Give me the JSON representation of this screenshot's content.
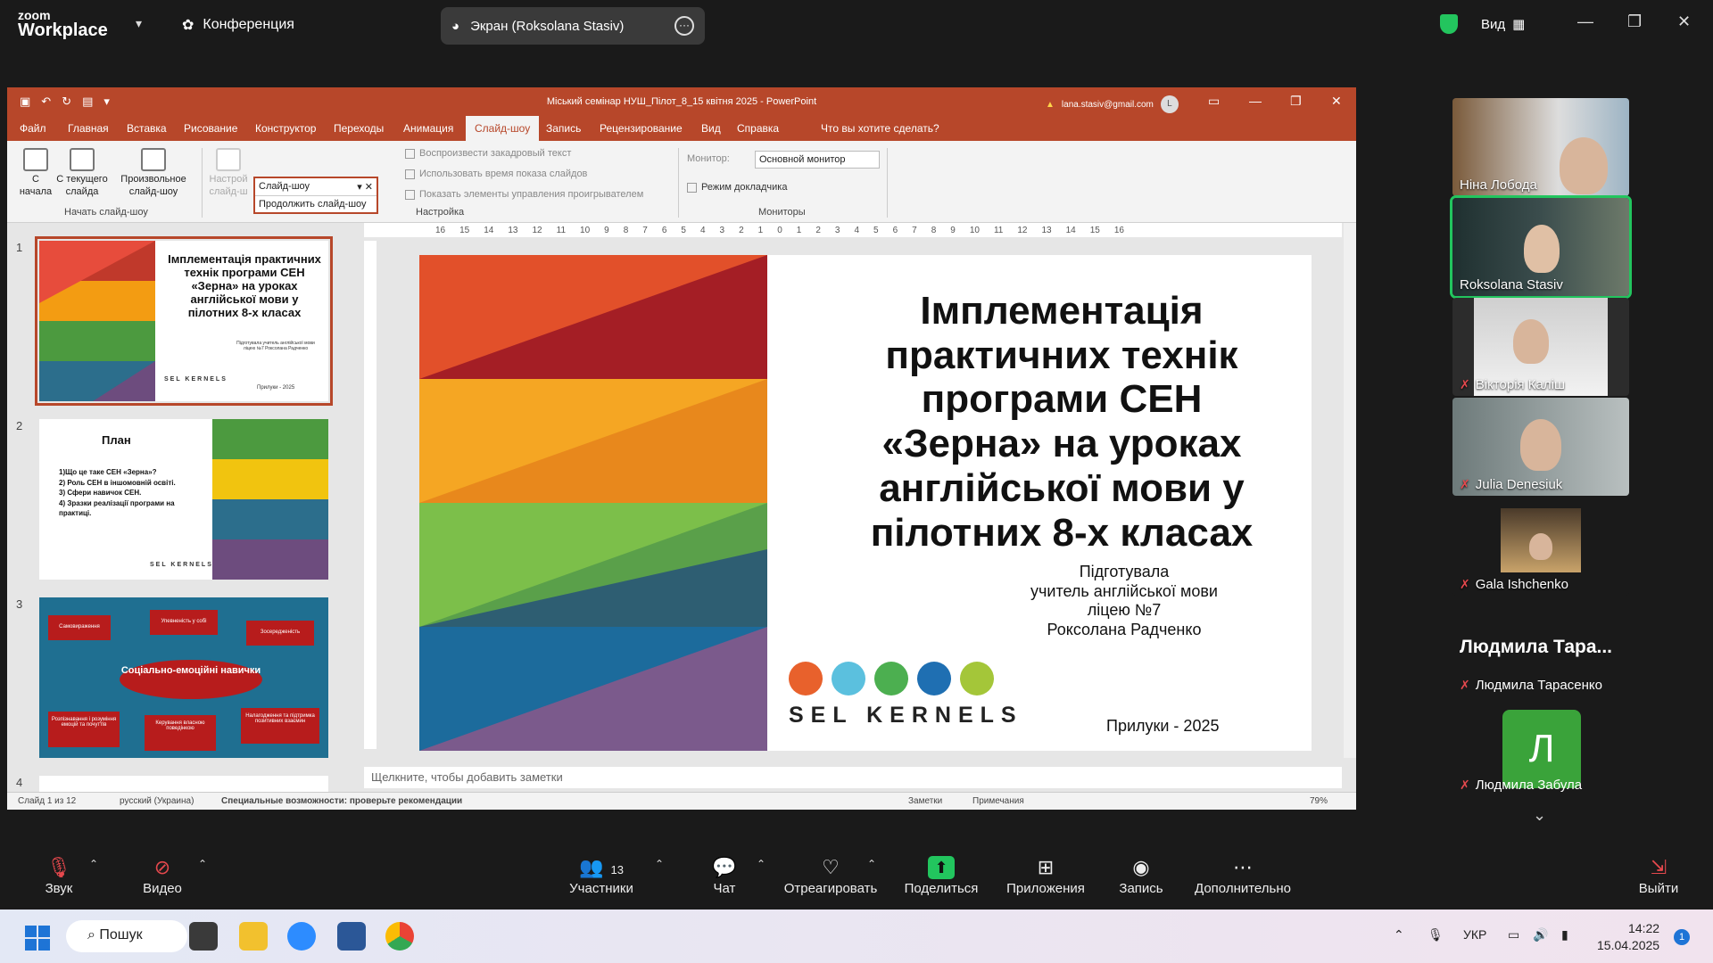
{
  "zoom": {
    "brand_line1": "zoom",
    "brand_line2": "Workplace",
    "conference_label": "Конференция",
    "screen_share_label": "Экран (Roksolana Stasiv)",
    "view_label": "Вид"
  },
  "ppt": {
    "doc_title": "Міський семінар НУШ_Пілот_8_15 квітня 2025  -  PowerPoint",
    "account_email": "lana.stasiv@gmail.com",
    "account_initial": "L",
    "tabs": [
      "Файл",
      "Главная",
      "Вставка",
      "Рисование",
      "Конструктор",
      "Переходы",
      "Анимация",
      "Слайд-шоу",
      "Запись",
      "Рецензирование",
      "Вид",
      "Справка",
      "Что вы хотите сделать?"
    ],
    "ribbon": {
      "from_start": "С\nначала",
      "from_current": "С текущего\nслайда",
      "custom_show": "Произвольное\nслайд-шоу",
      "group_start": "Начать слайд-шоу",
      "setup_partial": "Настрой\nслайд-ш",
      "dropdown_value": "Слайд-шоу",
      "dropdown_item": "Продолжить слайд-шоу",
      "chk_narration": "Воспроизвести закадровый текст",
      "chk_timings": "Использовать время показа слайдов",
      "chk_controls": "Показать элементы управления проигрывателем",
      "group_setup": "Настройка",
      "monitor_label": "Монитор:",
      "monitor_value": "Основной монитор",
      "presenter_view": "Режим докладчика",
      "group_monitors": "Мониторы"
    },
    "thumb_nums": [
      "1",
      "2",
      "3",
      "4"
    ],
    "thumb1": {
      "title": "Імплементація практичних технік програми СЕН «Зерна» на уроках англійської мови у пілотних 8-х класах",
      "small": "Підготувала учитель англійської мови ліцею №7 Роксолана Радченко",
      "city": "Прилуки - 2025",
      "logo": "SEL KERNELS"
    },
    "thumb2": {
      "title": "План",
      "items": [
        "1)Що це таке СЕН «Зерна»?",
        "2) Роль СЕН в іншомовній освіті.",
        "3) Сфери навичок СЕН.",
        "4) Зразки реалізації програми на практиці."
      ],
      "logo": "SEL KERNELS"
    },
    "thumb3": {
      "center": "Соціально-емоційні навички",
      "boxes": [
        "Самовираження",
        "Упевненість у собі",
        "Зосередженість",
        "Розпізнавання і розуміння емоцій та почуттів",
        "Керування власною поведінкою",
        "Налагодження та підтримка позитивних взаємин"
      ]
    },
    "ruler_ticks": [
      "16",
      "15",
      "14",
      "13",
      "12",
      "11",
      "10",
      "9",
      "8",
      "7",
      "6",
      "5",
      "4",
      "3",
      "2",
      "1",
      "0",
      "1",
      "2",
      "3",
      "4",
      "5",
      "6",
      "7",
      "8",
      "9",
      "10",
      "11",
      "12",
      "13",
      "14",
      "15",
      "16"
    ],
    "slide": {
      "title_lines": [
        "Імплементація",
        "практичних технік",
        "програми СЕН",
        "«Зерна» на уроках",
        "англійської мови у",
        "пілотних 8-х класах"
      ],
      "prep_lines": [
        "Підготувала",
        "учитель англійської мови",
        "ліцею №7",
        "Роксолана Радченко"
      ],
      "city": "Прилуки - 2025",
      "logo_text": "SEL  KERNELS",
      "logo_colors": [
        "#e8612c",
        "#5bc0de",
        "#4caf50",
        "#1f6fb2",
        "#a4c639"
      ]
    },
    "notes_placeholder": "Щелкните, чтобы добавить заметки",
    "status": {
      "slide_of": "Слайд 1 из 12",
      "language": "русский (Украина)",
      "accessibility": "Специальные возможности: проверьте рекомендации",
      "notes": "Заметки",
      "comments": "Примечания",
      "zoom": "79%"
    }
  },
  "participants": [
    {
      "name": "Ніна Лобода",
      "muted": false
    },
    {
      "name": "Roksolana Stasiv",
      "muted": false,
      "active": true
    },
    {
      "name": "Вікторія Каліш",
      "muted": true
    },
    {
      "name": "Julia Denesiuk",
      "muted": true
    },
    {
      "name": "Gala Ishchenko",
      "muted": true
    }
  ],
  "participant_big_name": "Людмила  Тара...",
  "participant_sub_name": "Людмила Тарасенко",
  "participant_l_initial": "Л",
  "participant_l_name": "Людмила Забула",
  "toolbar": {
    "audio": "Звук",
    "video": "Видео",
    "participants": "Участники",
    "participants_count": "13",
    "chat": "Чат",
    "react": "Отреагировать",
    "share": "Поделиться",
    "apps": "Приложения",
    "record": "Запись",
    "more": "Дополнительно",
    "leave": "Выйти"
  },
  "taskbar": {
    "search": "Пошук",
    "lang": "УКР",
    "time": "14:22",
    "date": "15.04.2025",
    "notifications": "1"
  }
}
